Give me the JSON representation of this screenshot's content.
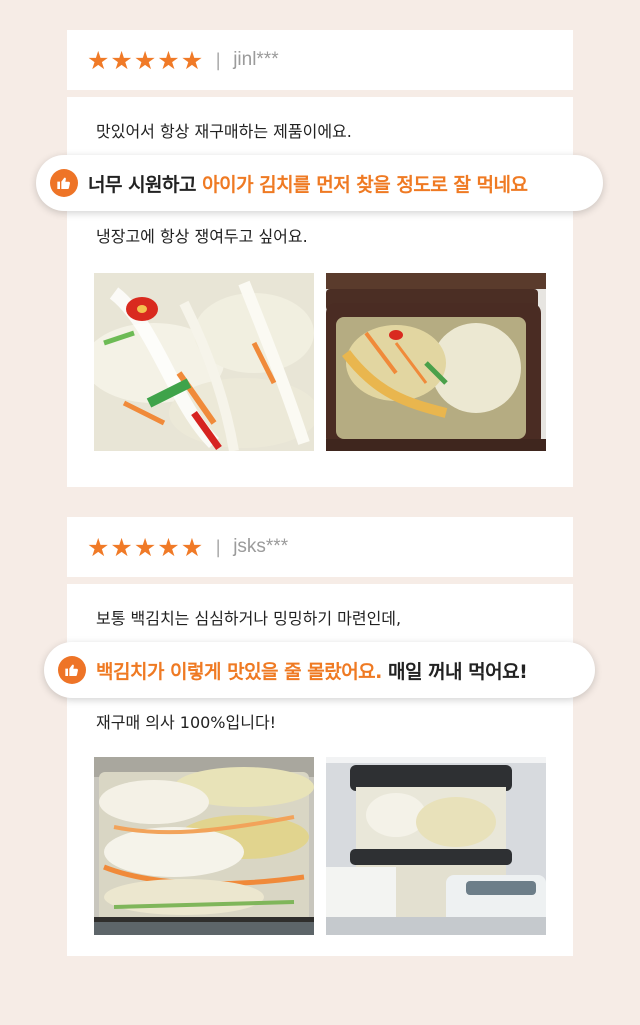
{
  "reviews": [
    {
      "rating": 5,
      "separator": "|",
      "user": "jinl***",
      "line1": "맛있어서 항상 재구매하는 제품이에요.",
      "highlight": {
        "plain_before": "너무 시원하고 ",
        "orange": "아이가 김치를 먼저 찾을 정도로 잘 먹네요",
        "plain_after": ""
      },
      "line2": "냉장고에 항상 쟁여두고 싶어요."
    },
    {
      "rating": 5,
      "separator": "|",
      "user": "jsks***",
      "line1": "보통 백김치는 심심하거나 밍밍하기 마련인데,",
      "highlight": {
        "plain_before": "",
        "orange": "백김치가 이렇게 맛있을 줄 몰랐어요.",
        "plain_after": " 매일 꺼내 먹어요!"
      },
      "line2": "재구매 의사 100%입니다!"
    }
  ],
  "icons": {
    "star": "star-icon",
    "thumb": "thumbs-up-icon"
  },
  "colors": {
    "background": "#f6ece6",
    "accent": "#ef7a23",
    "star": "#f07a27"
  }
}
